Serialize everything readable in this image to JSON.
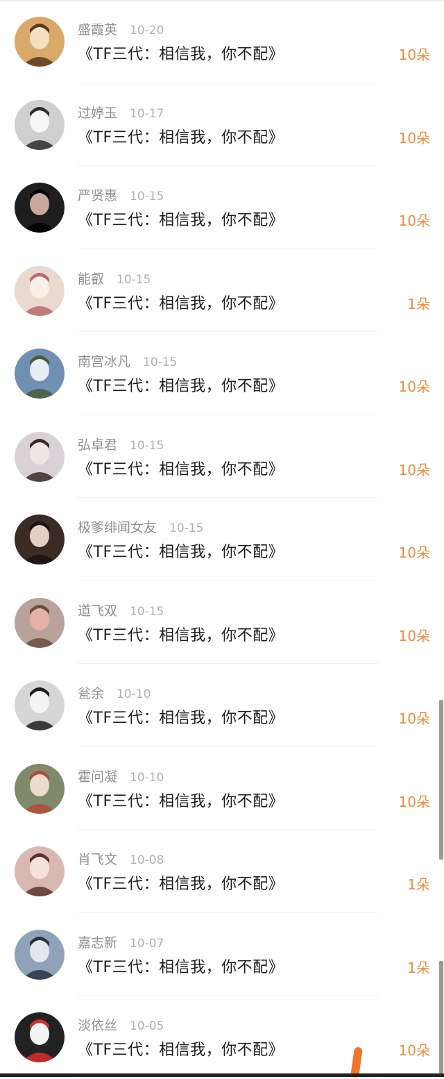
{
  "gift_list": [
    {
      "name": "盛霞英",
      "date": "10-20",
      "gift": "《TF三代：相信我，你不配》",
      "count": "10朵",
      "avatar": {
        "bg": "#d9a96a",
        "fg": "#f2e0c0",
        "accent": "#5a3a22"
      }
    },
    {
      "name": "过婷玉",
      "date": "10-17",
      "gift": "《TF三代：相信我，你不配》",
      "count": "10朵",
      "avatar": {
        "bg": "#cfcfcf",
        "fg": "#f6f6f6",
        "accent": "#2d2d2d"
      }
    },
    {
      "name": "严贤惠",
      "date": "10-15",
      "gift": "《TF三代：相信我，你不配》",
      "count": "10朵",
      "avatar": {
        "bg": "#1e1e1e",
        "fg": "#c9a79a",
        "accent": "#000000"
      }
    },
    {
      "name": "能叡",
      "date": "10-15",
      "gift": "《TF三代：相信我，你不配》",
      "count": "1朵",
      "avatar": {
        "bg": "#e9d9cf",
        "fg": "#f7efe8",
        "accent": "#b86b6b"
      }
    },
    {
      "name": "南宫冰凡",
      "date": "10-15",
      "gift": "《TF三代：相信我，你不配》",
      "count": "10朵",
      "avatar": {
        "bg": "#6f8fb3",
        "fg": "#e8eef5",
        "accent": "#4a5c3a"
      }
    },
    {
      "name": "弘卓君",
      "date": "10-15",
      "gift": "《TF三代：相信我，你不配》",
      "count": "10朵",
      "avatar": {
        "bg": "#d8d2d6",
        "fg": "#f0e6e0",
        "accent": "#3a2a2a"
      }
    },
    {
      "name": "极爹绯闻女友",
      "date": "10-15",
      "gift": "《TF三代：相信我，你不配》",
      "count": "10朵",
      "avatar": {
        "bg": "#3a2b24",
        "fg": "#e6cfc0",
        "accent": "#1a1212"
      }
    },
    {
      "name": "道飞双",
      "date": "10-15",
      "gift": "《TF三代：相信我，你不配》",
      "count": "10朵",
      "avatar": {
        "bg": "#b8a29a",
        "fg": "#e4b3a8",
        "accent": "#6e4c44"
      }
    },
    {
      "name": "瓮余",
      "date": "10-10",
      "gift": "《TF三代：相信我，你不配》",
      "count": "10朵",
      "avatar": {
        "bg": "#d6d6d6",
        "fg": "#f4f4f4",
        "accent": "#1e1e1e"
      }
    },
    {
      "name": "霍问凝",
      "date": "10-10",
      "gift": "《TF三代：相信我，你不配》",
      "count": "10朵",
      "avatar": {
        "bg": "#7f8a6a",
        "fg": "#eadcd0",
        "accent": "#b34a3a"
      }
    },
    {
      "name": "肖飞文",
      "date": "10-08",
      "gift": "《TF三代：相信我，你不配》",
      "count": "1朵",
      "avatar": {
        "bg": "#d8b8b0",
        "fg": "#f4e2da",
        "accent": "#5a3330"
      }
    },
    {
      "name": "嘉志新",
      "date": "10-07",
      "gift": "《TF三代：相信我，你不配》",
      "count": "1朵",
      "avatar": {
        "bg": "#8fa3b8",
        "fg": "#e2e8ee",
        "accent": "#2a3440"
      }
    },
    {
      "name": "淡依丝",
      "date": "10-05",
      "gift": "《TF三代：相信我，你不配》",
      "count": "10朵",
      "avatar": {
        "bg": "#222222",
        "fg": "#f4f4f4",
        "accent": "#d92a2a"
      }
    }
  ]
}
